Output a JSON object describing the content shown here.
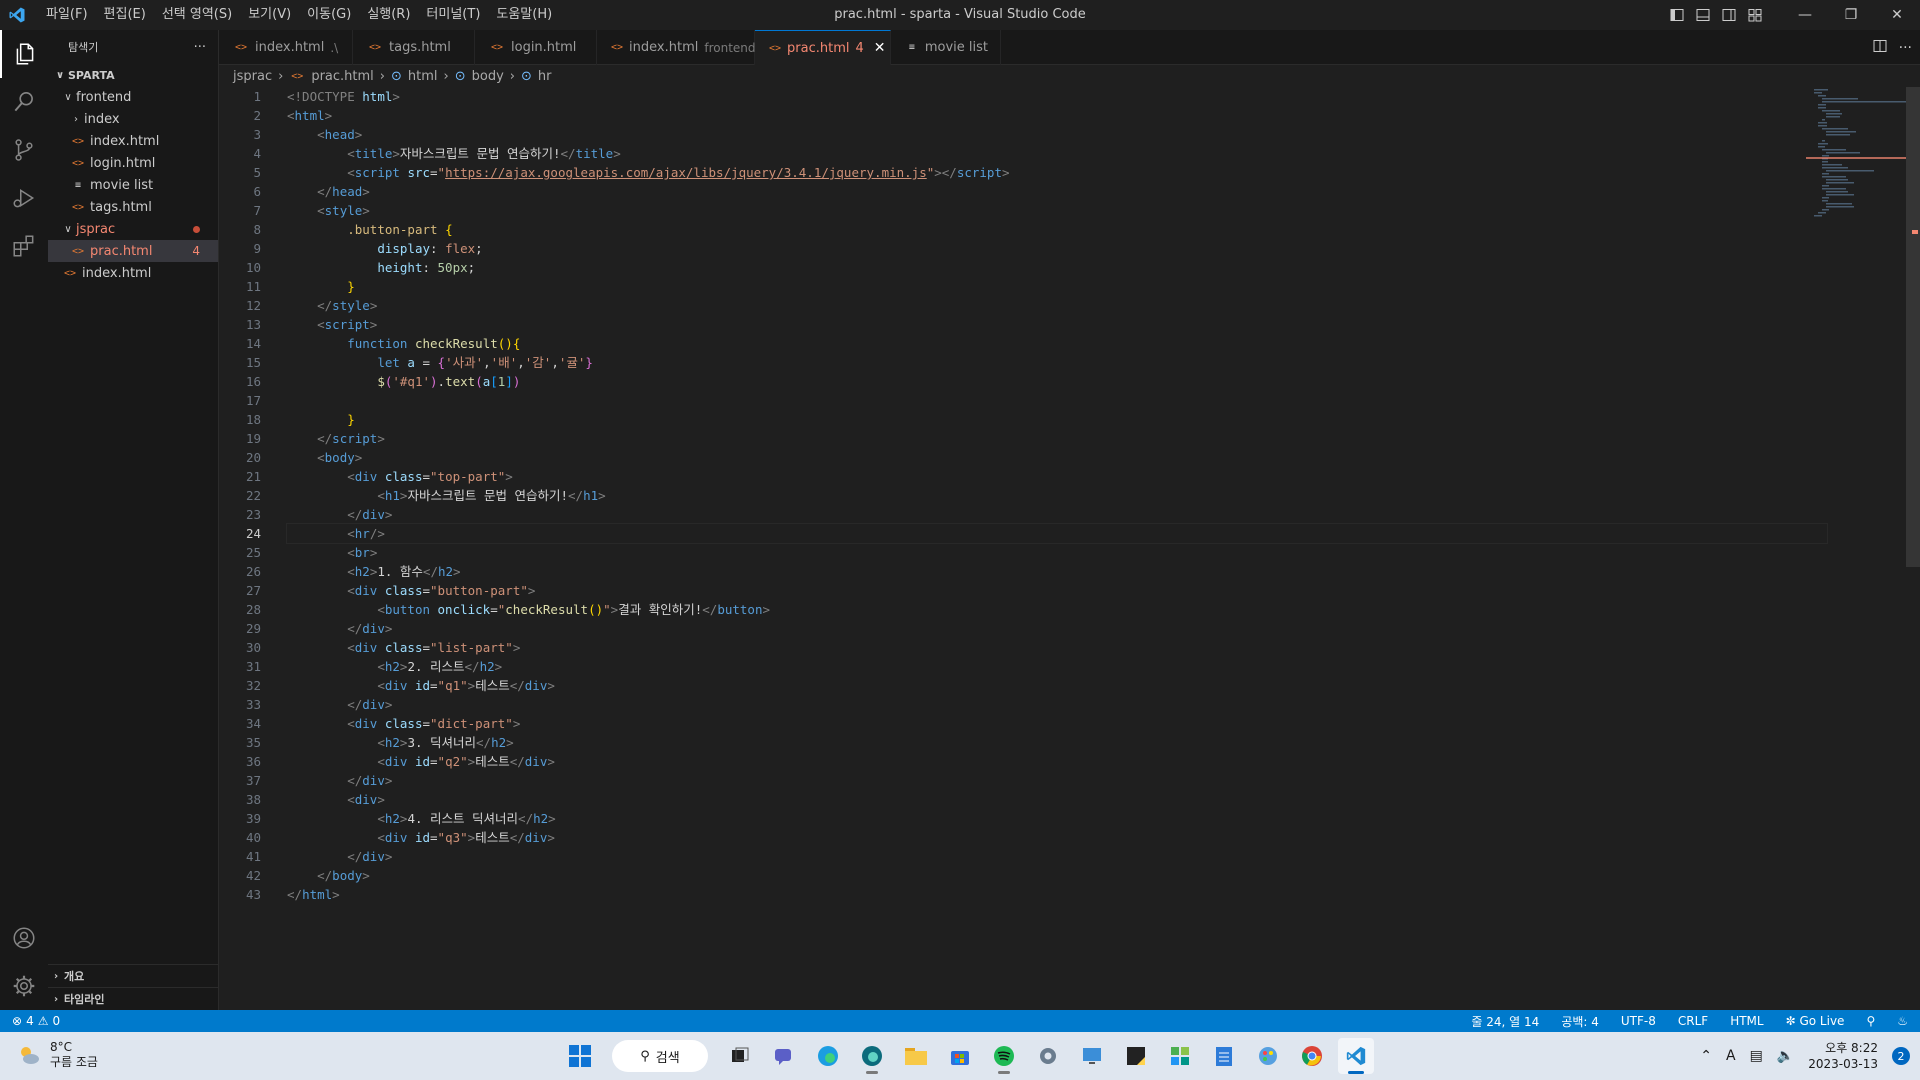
{
  "title_bar": {
    "menus": [
      "파일(F)",
      "편집(E)",
      "선택 영역(S)",
      "보기(V)",
      "이동(G)",
      "실행(R)",
      "터미널(T)",
      "도움말(H)"
    ],
    "window_title": "prac.html - sparta - Visual Studio Code"
  },
  "sidebar": {
    "header": "탐색기",
    "more": "···",
    "root": "SPARTA",
    "tree": [
      {
        "label": "frontend",
        "type": "folder-open",
        "depth": 1
      },
      {
        "label": "index",
        "type": "folder-closed",
        "depth": 2
      },
      {
        "label": "index.html",
        "type": "html",
        "depth": 2
      },
      {
        "label": "login.html",
        "type": "html",
        "depth": 2
      },
      {
        "label": "movie list",
        "type": "text",
        "depth": 2
      },
      {
        "label": "tags.html",
        "type": "html",
        "depth": 2
      },
      {
        "label": "jsprac",
        "type": "folder-open-error",
        "depth": 1
      },
      {
        "label": "prac.html",
        "type": "html-error",
        "depth": 2,
        "badge": "4"
      },
      {
        "label": "index.html",
        "type": "html",
        "depth": 1
      }
    ],
    "sections": [
      "개요",
      "타임라인"
    ]
  },
  "tabs": [
    {
      "label": "index.html",
      "desc": ".\\"
    },
    {
      "label": "tags.html",
      "desc": ""
    },
    {
      "label": "login.html",
      "desc": ""
    },
    {
      "label": "index.html",
      "desc": "frontend"
    },
    {
      "label": "prac.html",
      "desc": "",
      "count": "4",
      "active": true
    },
    {
      "label": "movie list",
      "desc": ""
    }
  ],
  "breadcrumb": [
    "jsprac",
    "prac.html",
    "html",
    "body",
    "hr"
  ],
  "editor": {
    "current_line": 24,
    "line_count": 43
  },
  "status": {
    "errors": "4",
    "warnings": "0",
    "position": "줄 24, 열 14",
    "spaces": "공백: 4",
    "encoding": "UTF-8",
    "eol": "CRLF",
    "language": "HTML",
    "golive": "Go Live"
  },
  "taskbar": {
    "temp": "8°C",
    "weather": "구름 조금",
    "search": "검색",
    "time": "오후 8:22",
    "date": "2023-03-13",
    "ime": "A",
    "notifications": "2"
  },
  "colors": {
    "accent": "#007acc",
    "error": "#f48771",
    "editor_bg": "#1f1f1f"
  }
}
